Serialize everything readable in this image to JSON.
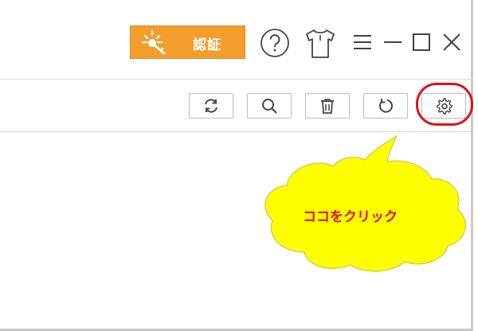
{
  "titlebar": {
    "auth_button_label": "認証",
    "icons": [
      "key-sparkle-icon",
      "help-icon",
      "skin-icon",
      "menu-icon",
      "minimize-icon",
      "maximize-icon",
      "close-icon"
    ]
  },
  "toolbar": {
    "buttons": [
      "refresh-icon",
      "search-icon",
      "trash-icon",
      "undo-icon",
      "gear-icon"
    ]
  },
  "annotation": {
    "callout_text": "ココをクリック",
    "callout_color": "#ffff00",
    "highlight_color": "#e0101a"
  },
  "colors": {
    "auth_button": "#f39d2c",
    "icon_stroke": "#444444"
  }
}
